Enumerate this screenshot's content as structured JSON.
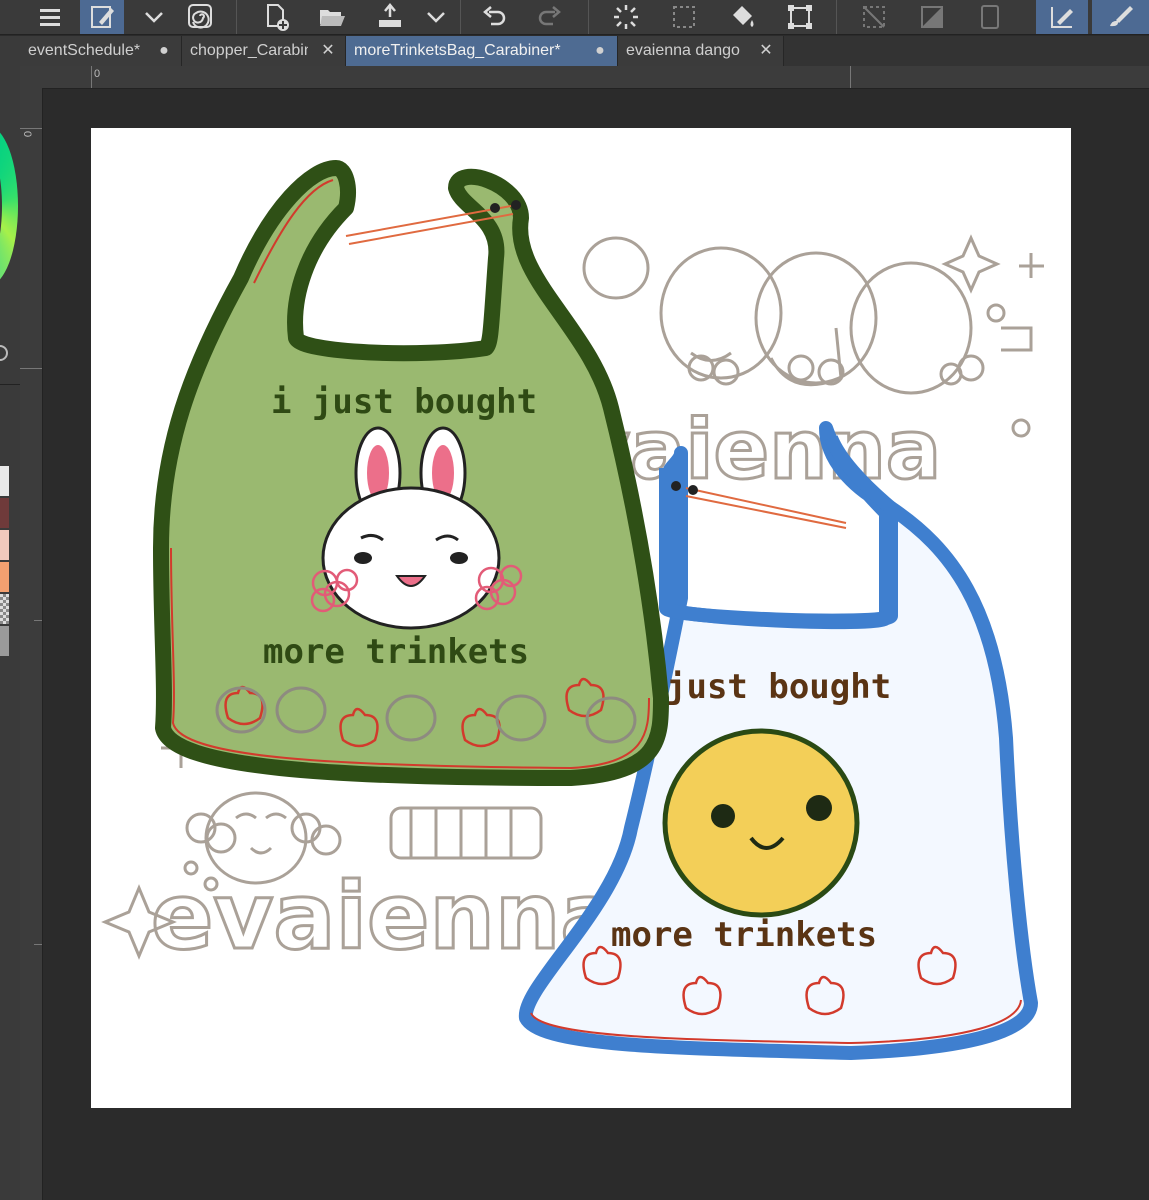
{
  "toolbar": {
    "buttons": [
      {
        "name": "menu",
        "icon": "menu-icon"
      },
      {
        "name": "pen-tool",
        "icon": "pen-edit-icon",
        "active": true
      },
      {
        "name": "dropdown",
        "icon": "chevron-down-icon"
      },
      {
        "name": "spiral-tool",
        "icon": "spiral-icon"
      },
      {
        "name": "new-document",
        "icon": "new-document-icon"
      },
      {
        "name": "open-folder",
        "icon": "folder-open-icon"
      },
      {
        "name": "export",
        "icon": "export-icon"
      },
      {
        "name": "dropdown-2",
        "icon": "chevron-down-icon"
      },
      {
        "name": "undo",
        "icon": "undo-icon"
      },
      {
        "name": "redo",
        "icon": "redo-icon"
      },
      {
        "name": "loading",
        "icon": "spinner-icon"
      },
      {
        "name": "select-area",
        "icon": "select-area-icon"
      },
      {
        "name": "fill",
        "icon": "fill-bucket-icon"
      },
      {
        "name": "transform",
        "icon": "transform-icon"
      },
      {
        "name": "clear-selection",
        "icon": "clear-selection-icon"
      },
      {
        "name": "invert-selection",
        "icon": "invert-selection-icon"
      },
      {
        "name": "crop",
        "icon": "crop-icon"
      },
      {
        "name": "edit-layer",
        "icon": "edit-layer-icon",
        "active": true
      },
      {
        "name": "brush",
        "icon": "brush-icon",
        "active": true
      }
    ]
  },
  "tabs": [
    {
      "label": "eventSchedule*",
      "control": "●",
      "active": false
    },
    {
      "label": "chopper_Carabiner",
      "control": "✕",
      "active": false
    },
    {
      "label": "moreTrinketsBag_Carabiner*",
      "control": "●",
      "active": true
    },
    {
      "label": "evaienna dango",
      "control": "✕",
      "active": false
    }
  ],
  "rulers": {
    "origin_h": "0",
    "origin_v": "0"
  },
  "swatches": [
    "#e9e9e9",
    "#6f3a3a",
    "#f1c9bd",
    "#f3a070",
    "#9a9a9a"
  ],
  "artwork": {
    "watermark": "evaienna",
    "green_bag": {
      "line1": "i just bought",
      "line2": "more trinkets",
      "fill": "#9ab970",
      "outline": "#2f5016",
      "text_color": "#2f4a14"
    },
    "blue_bag": {
      "line1": "just bought",
      "line2": "more trinkets",
      "fill": "#f3f8ff",
      "outline": "#3f7fcf",
      "text_color": "#5a3414"
    }
  }
}
